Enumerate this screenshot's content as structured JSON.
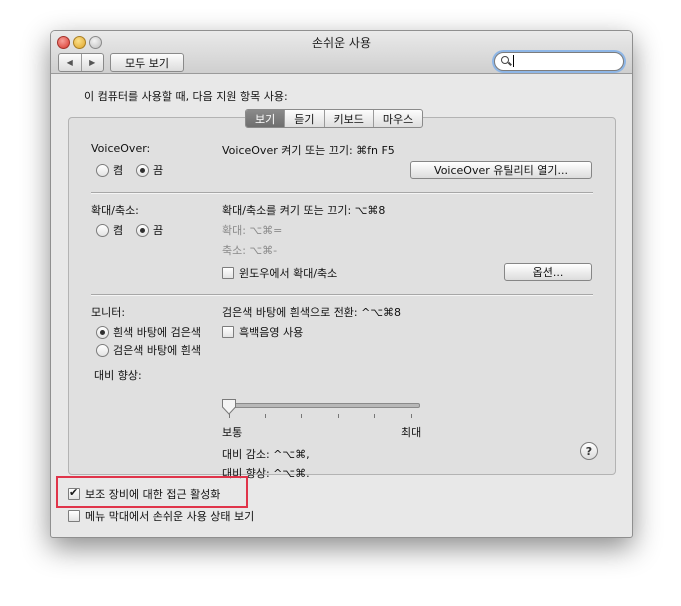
{
  "window": {
    "title": "손쉬운 사용"
  },
  "toolbar": {
    "back_icon": "back-arrow-icon",
    "forward_icon": "forward-arrow-icon",
    "show_all_label": "모두 보기",
    "search_value": "",
    "search_icon": "search-icon"
  },
  "intro_label": "이 컴퓨터를 사용할 때, 다음 지원 항목 사용:",
  "tabs": [
    {
      "label": "보기",
      "selected": true
    },
    {
      "label": "듣기",
      "selected": false
    },
    {
      "label": "키보드",
      "selected": false
    },
    {
      "label": "마우스",
      "selected": false
    }
  ],
  "voiceover": {
    "label": "VoiceOver:",
    "on_label": "켬",
    "off_label": "끔",
    "selected": "off",
    "shortcut_text": "VoiceOver 켜기 또는 끄기: ⌘fn F5",
    "utility_button": "VoiceOver 유틸리티 열기..."
  },
  "zoom": {
    "label": "확대/축소:",
    "on_label": "켬",
    "off_label": "끔",
    "selected": "off",
    "toggle_text": "확대/축소를 켜기 또는 끄기: ⌥⌘8",
    "zoom_in_text": "확대: ⌥⌘=",
    "zoom_out_text": "축소: ⌥⌘-",
    "window_zoom_label": "윈도우에서 확대/축소",
    "window_zoom_checked": false,
    "options_button": "옵션..."
  },
  "display": {
    "label": "모니터:",
    "black_on_white": "흰색 바탕에 검은색",
    "white_on_black": "검은색 바탕에 흰색",
    "selected": "black_on_white",
    "switch_text": "검은색 바탕에 흰색으로 전환: ^⌥⌘8",
    "grayscale_label": "흑백음영 사용",
    "grayscale_checked": false,
    "contrast_label": "대비 향상:",
    "contrast_min_label": "보통",
    "contrast_max_label": "최대",
    "contrast_value": 0,
    "contrast_decrease_text": "대비 감소: ^⌥⌘,",
    "contrast_increase_text": "대비 향상: ^⌥⌘."
  },
  "help_label": "?",
  "footer": {
    "assistive_devices_label": "보조 장비에 대한 접근 활성화",
    "assistive_devices_checked": true,
    "menu_bar_status_label": "메뉴 막대에서 손쉬운 사용 상태 보기",
    "menu_bar_status_checked": false
  },
  "colors": {
    "highlight_border": "#e0344a",
    "selected_tab": "#7a7a7a",
    "search_focus_ring": "#8eb6e6"
  }
}
